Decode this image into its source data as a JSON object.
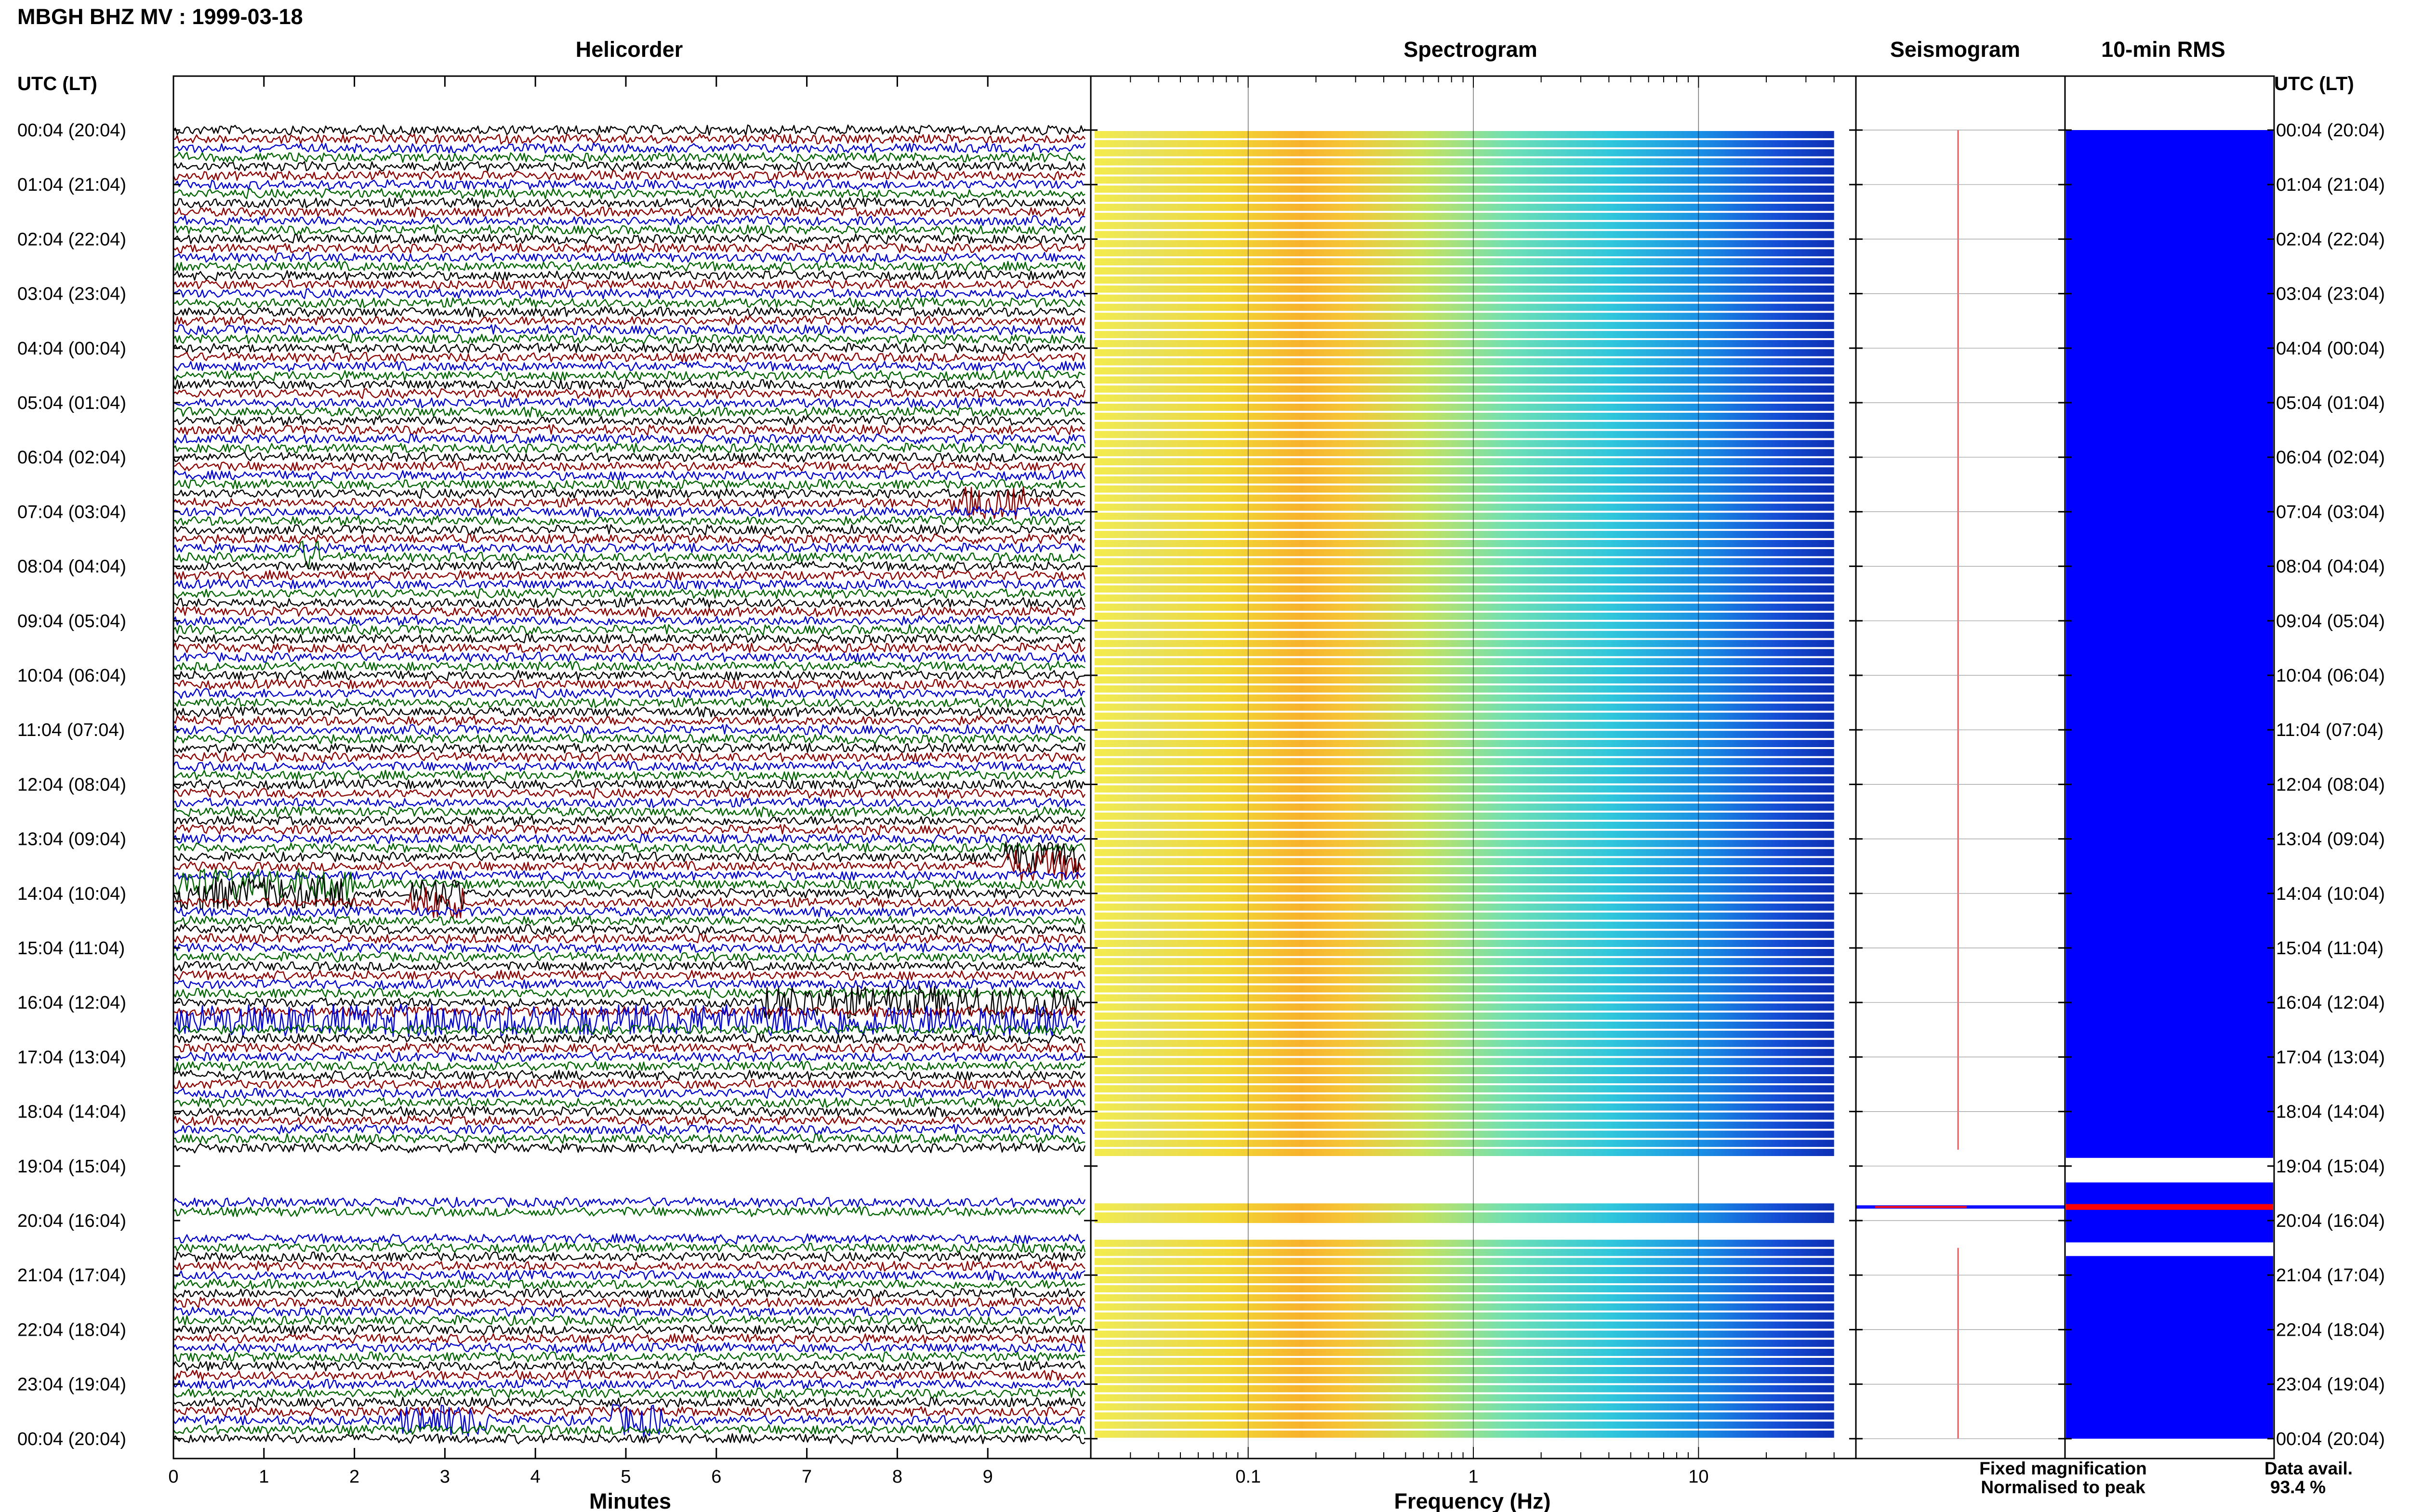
{
  "title": "MBGH BHZ MV : 1999-03-18",
  "panels": {
    "helicorder": "Helicorder",
    "spectrogram": "Spectrogram",
    "seismogram": "Seismogram",
    "rms": "10-min RMS"
  },
  "axis_labels": {
    "time_header": "UTC (LT)",
    "minutes": "Minutes",
    "frequency": "Frequency (Hz)"
  },
  "legend": {
    "fixed": "Fixed magnification",
    "normalised": "Normalised to peak",
    "fixed_color": "#1010ff",
    "normalised_color": "#ff1010"
  },
  "data_avail": {
    "label": "Data avail.",
    "value": "93.4 %"
  },
  "colors": {
    "trace_cycle": [
      "#000000",
      "#8b0000",
      "#0000cd",
      "#006400"
    ],
    "rms_fill": "#0000ff",
    "rms_spike": "#ff0000"
  },
  "chart_data": [
    {
      "type": "line",
      "name": "helicorder",
      "title": "Helicorder",
      "xlabel": "Minutes",
      "x_ticks": [
        0,
        1,
        2,
        3,
        4,
        5,
        6,
        7,
        8,
        9
      ],
      "xlim": [
        0,
        10
      ],
      "row_labels": [
        "00:04 (20:04)",
        "01:04 (21:04)",
        "02:04 (22:04)",
        "03:04 (23:04)",
        "04:04 (00:04)",
        "05:04 (01:04)",
        "06:04 (02:04)",
        "07:04 (03:04)",
        "08:04 (04:04)",
        "09:04 (05:04)",
        "10:04 (06:04)",
        "11:04 (07:04)",
        "12:04 (08:04)",
        "13:04 (09:04)",
        "14:04 (10:04)",
        "15:04 (11:04)",
        "16:04 (12:04)",
        "17:04 (13:04)",
        "18:04 (14:04)",
        "19:04 (15:04)",
        "20:04 (16:04)",
        "21:04 (17:04)",
        "22:04 (18:04)",
        "23:04 (19:04)",
        "00:04 (20:04)"
      ],
      "traces_per_hour": 6,
      "gap_hours": [
        [
          18.7,
          19.6
        ],
        [
          19.85,
          20.3
        ]
      ],
      "events": [
        {
          "hour": 6.85,
          "minute": 8.6,
          "duration_min": 0.8
        },
        {
          "hour": 7.8,
          "minute": 1.3,
          "duration_min": 0.3
        },
        {
          "hour": 13.4,
          "minute": 9.2,
          "duration_min": 0.8
        },
        {
          "hour": 13.9,
          "minute": 0.0,
          "duration_min": 2.0
        },
        {
          "hour": 14.1,
          "minute": 2.6,
          "duration_min": 0.6
        },
        {
          "hour": 16.0,
          "minute": 6.5,
          "duration_min": 3.5
        },
        {
          "hour": 16.3,
          "minute": 0.0,
          "duration_min": 10.0
        },
        {
          "hour": 19.3,
          "minute": 4.1,
          "duration_min": 2.5
        },
        {
          "hour": 19.5,
          "minute": 6.5,
          "duration_min": 1.2
        },
        {
          "hour": 23.7,
          "minute": 2.5,
          "duration_min": 1.0
        },
        {
          "hour": 23.7,
          "minute": 4.8,
          "duration_min": 0.6
        }
      ]
    },
    {
      "type": "heatmap",
      "name": "spectrogram",
      "title": "Spectrogram",
      "xlabel": "Frequency (Hz)",
      "x_scale": "log",
      "xlim": [
        0.02,
        50
      ],
      "x_ticks": [
        0.1,
        1,
        10
      ],
      "x_tick_labels": [
        "0.1",
        "1",
        "10"
      ],
      "max_frequency": 40,
      "rows_per_hour": 6
    },
    {
      "type": "line",
      "name": "seismogram",
      "title": "Seismogram"
    },
    {
      "type": "bar",
      "name": "rms",
      "title": "10-min RMS",
      "gap_hours": [
        [
          18.85,
          19.3
        ],
        [
          20.4,
          20.65
        ]
      ],
      "peak_hour": 19.75
    }
  ]
}
